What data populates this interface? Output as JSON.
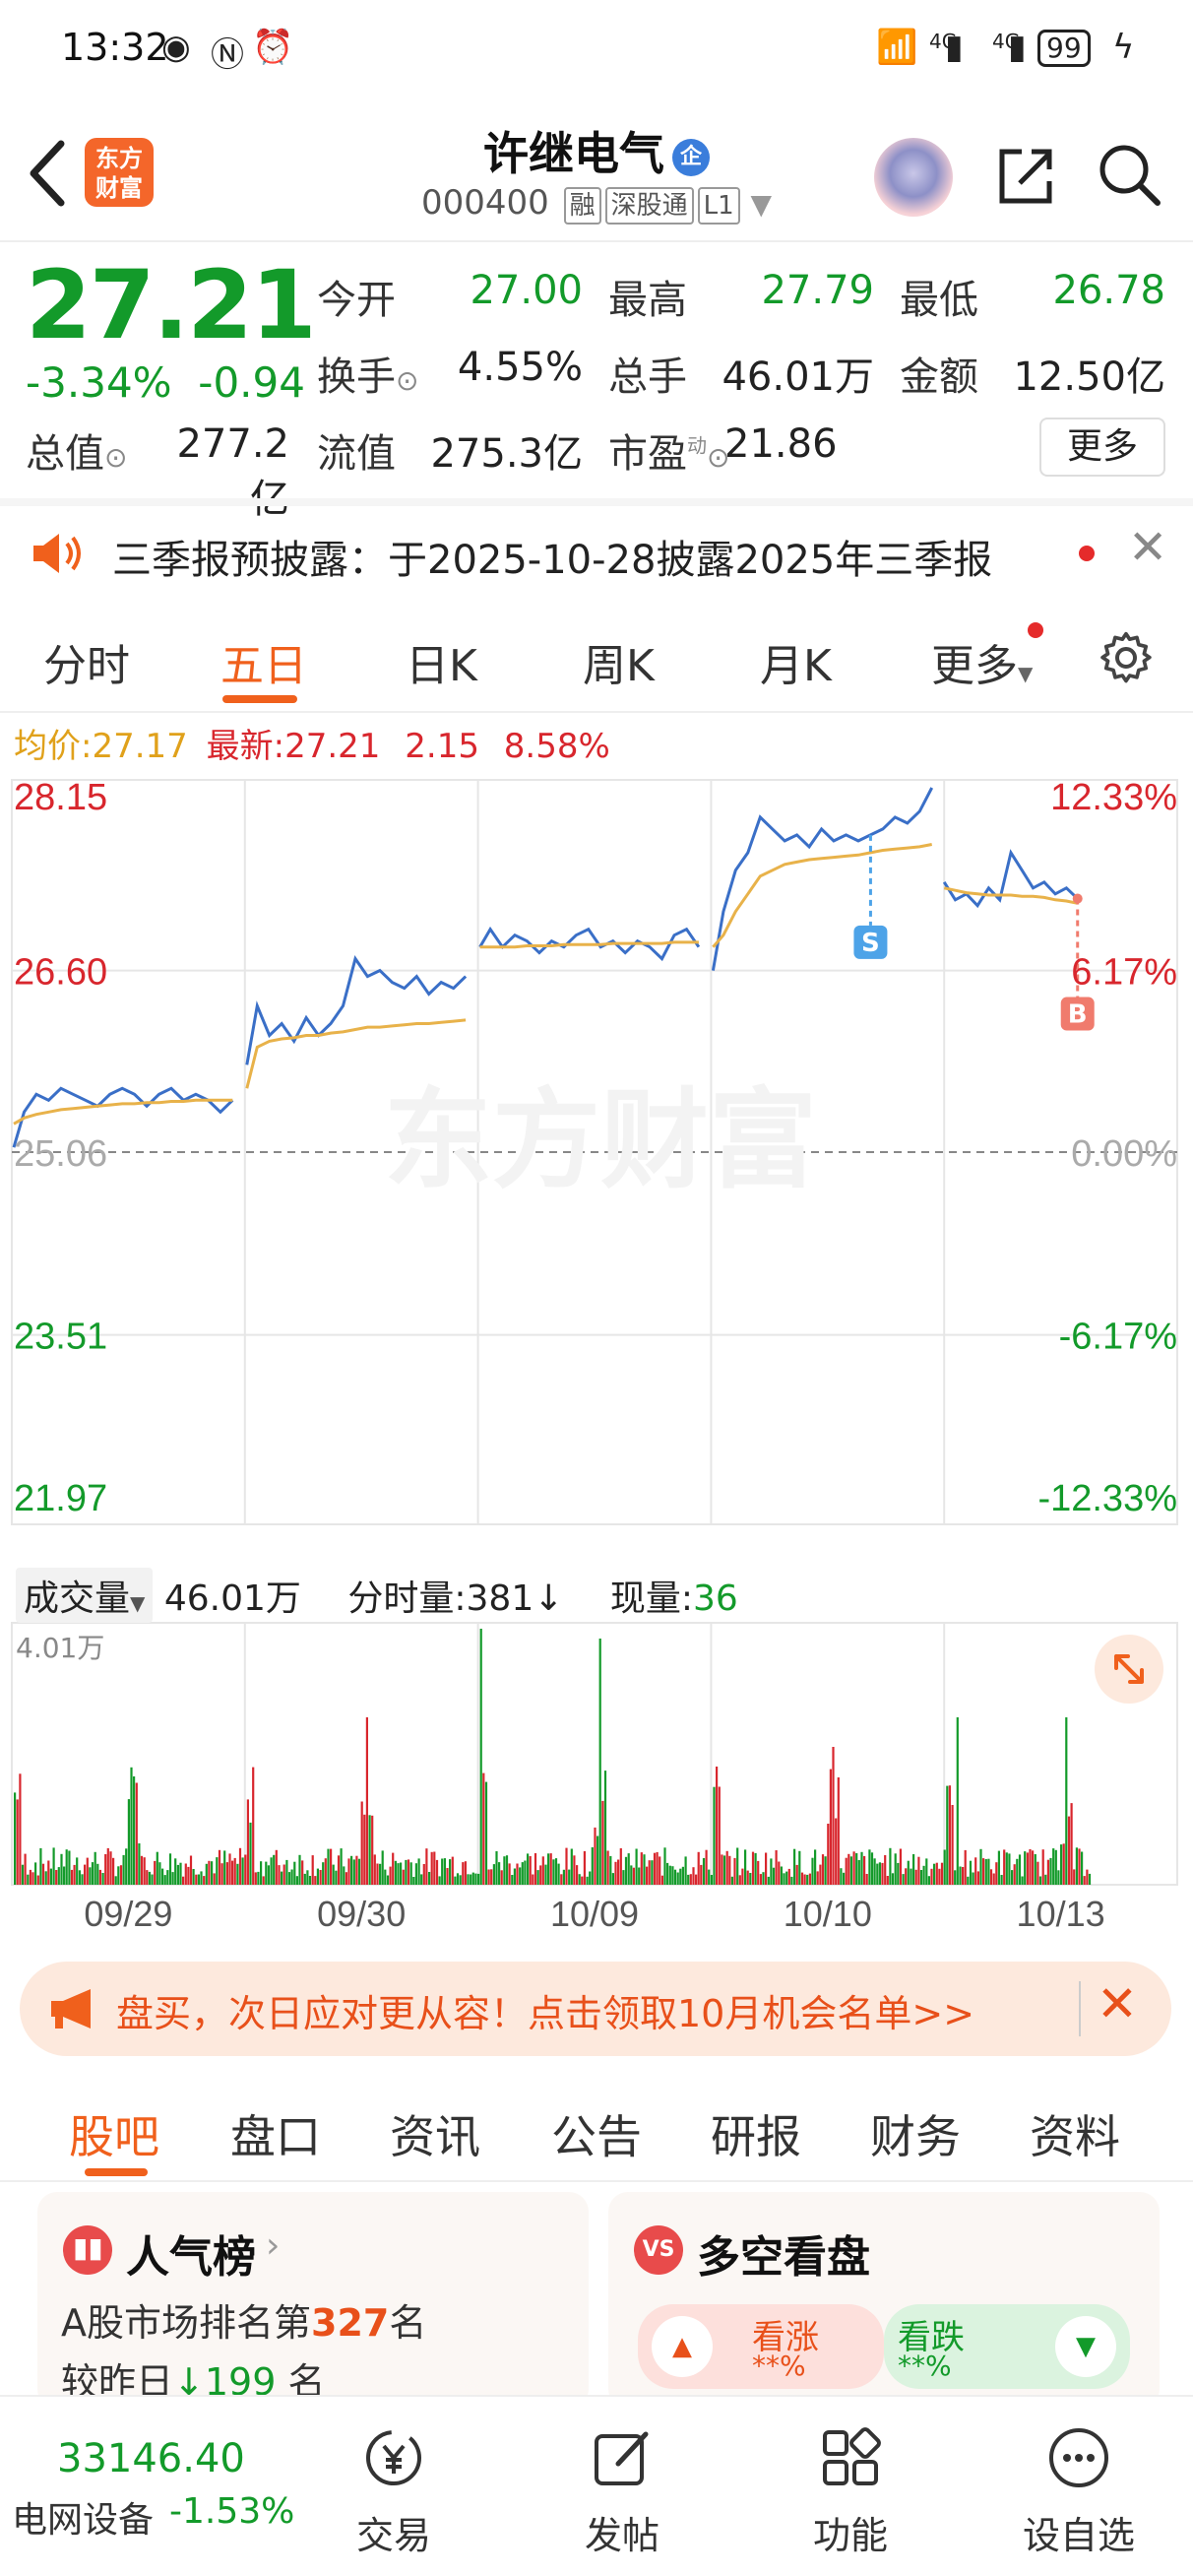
{
  "status_bar": {
    "time": "13:32",
    "battery": "99",
    "network": "4G"
  },
  "header": {
    "brand_logo": "东方\n财富",
    "stock_name": "许继电气",
    "name_badge": "企",
    "stock_code": "000400",
    "tags": [
      "融",
      "深股通",
      "L1"
    ]
  },
  "quote": {
    "price": "27.21",
    "change_pct": "-3.34%",
    "change": "-0.94",
    "fields": [
      {
        "label": "今开",
        "value": "27.00",
        "color": "green"
      },
      {
        "label": "最高",
        "value": "27.79",
        "color": "green"
      },
      {
        "label": "最低",
        "value": "26.78",
        "color": "green"
      },
      {
        "label": "换手",
        "value": "4.55%",
        "color": "black"
      },
      {
        "label": "总手",
        "value": "46.01万",
        "color": "black"
      },
      {
        "label": "金额",
        "value": "12.50亿",
        "color": "black"
      },
      {
        "label": "总值",
        "value": "277.2亿",
        "color": "black"
      },
      {
        "label": "流值",
        "value": "275.3亿",
        "color": "black"
      },
      {
        "label": "市盈",
        "value": "21.86",
        "color": "black"
      }
    ],
    "pe_superscript": "动",
    "more_label": "更多"
  },
  "notice": {
    "text": "三季报预披露：于2025-10-28披露2025年三季报"
  },
  "chart_tabs": {
    "items": [
      "分时",
      "五日",
      "日K",
      "周K",
      "月K",
      "更多"
    ],
    "active": "五日"
  },
  "avg_line": {
    "avg_label": "均价:",
    "avg_value": "27.17",
    "latest_label": "最新:",
    "latest_value": "27.21",
    "latest_change": "2.15",
    "latest_pct": "8.58%"
  },
  "chart_data": {
    "type": "line",
    "title": "",
    "x_day_labels": [
      "09/29",
      "09/30",
      "10/09",
      "10/10",
      "10/13"
    ],
    "y_left_ticks": [
      "28.15",
      "26.60",
      "25.06",
      "23.51",
      "21.97"
    ],
    "y_right_ticks": [
      "12.33%",
      "6.17%",
      "0.00%",
      "-6.17%",
      "-12.33%"
    ],
    "ylim": [
      21.97,
      28.15
    ],
    "base_price": 25.06,
    "series": [
      {
        "name": "价格",
        "color": "#3a6fc7",
        "values": [
          25.1,
          25.4,
          25.55,
          25.5,
          25.6,
          25.55,
          25.5,
          25.45,
          25.55,
          25.6,
          25.55,
          25.45,
          25.55,
          25.6,
          25.5,
          25.55,
          25.5,
          25.4,
          25.5,
          25.8,
          26.3,
          26.05,
          26.15,
          26.0,
          26.2,
          26.05,
          26.15,
          26.3,
          26.7,
          26.55,
          26.6,
          26.5,
          26.45,
          26.55,
          26.4,
          26.5,
          26.45,
          26.55,
          26.8,
          26.95,
          26.8,
          26.9,
          26.85,
          26.75,
          26.85,
          26.8,
          26.9,
          26.95,
          26.8,
          26.85,
          26.75,
          26.85,
          26.8,
          26.7,
          26.9,
          26.95,
          26.8,
          26.6,
          27.1,
          27.45,
          27.6,
          27.9,
          27.8,
          27.7,
          27.75,
          27.65,
          27.8,
          27.7,
          27.75,
          27.7,
          27.75,
          27.8,
          27.9,
          27.85,
          27.95,
          28.15,
          27.35,
          27.2,
          27.25,
          27.15,
          27.3,
          27.2,
          27.6,
          27.45,
          27.3,
          27.35,
          27.25,
          27.3,
          27.21
        ]
      },
      {
        "name": "均价",
        "color": "#e8b24a",
        "values": [
          25.3,
          25.35,
          25.38,
          25.4,
          25.42,
          25.43,
          25.44,
          25.45,
          25.46,
          25.47,
          25.47,
          25.48,
          25.48,
          25.49,
          25.49,
          25.5,
          25.5,
          25.5,
          25.5,
          25.6,
          25.95,
          26.0,
          26.02,
          26.03,
          26.05,
          26.05,
          26.07,
          26.08,
          26.1,
          26.12,
          26.12,
          26.13,
          26.14,
          26.15,
          26.15,
          26.16,
          26.17,
          26.18,
          26.8,
          26.8,
          26.8,
          26.8,
          26.81,
          26.81,
          26.81,
          26.82,
          26.82,
          26.82,
          26.82,
          26.83,
          26.83,
          26.83,
          26.83,
          26.83,
          26.84,
          26.84,
          26.84,
          26.8,
          26.9,
          27.1,
          27.25,
          27.4,
          27.45,
          27.5,
          27.52,
          27.54,
          27.55,
          27.56,
          27.57,
          27.58,
          27.6,
          27.62,
          27.63,
          27.64,
          27.65,
          27.67,
          27.3,
          27.28,
          27.26,
          27.25,
          27.24,
          27.24,
          27.24,
          27.23,
          27.23,
          27.22,
          27.2,
          27.19,
          27.17
        ]
      }
    ],
    "markers": [
      {
        "label": "S",
        "color": "#4da3e8"
      },
      {
        "label": "B",
        "color": "#f07b6d"
      }
    ],
    "watermark": "东方财富"
  },
  "volume": {
    "label": "成交量",
    "total": "46.01万",
    "period_label": "分时量:",
    "period_value": "381",
    "now_label": "现量:",
    "now_value": "36",
    "max_label": "4.01万"
  },
  "promo": {
    "text": "盘买，次日应对更从容！点击领取10月机会名单>>"
  },
  "bottom_tabs": {
    "items": [
      "股吧",
      "盘口",
      "资讯",
      "公告",
      "研报",
      "财务",
      "资料"
    ],
    "active": "股吧"
  },
  "cards": {
    "popularity": {
      "title": "人气榜",
      "line1_prefix": "A股市场排名第",
      "line1_rank": "327",
      "line1_suffix": "名",
      "line2_prefix": "较昨日",
      "line2_value": "199",
      "line2_suffix": "名"
    },
    "sentiment": {
      "title": "多空看盘",
      "bull_label": "看涨",
      "bull_value": "**%",
      "bear_label": "看跌",
      "bear_value": "**%"
    }
  },
  "bottom_nav": {
    "index_value": "33146.40",
    "index_name": "电网设备",
    "index_change": "-1.53%",
    "items": [
      "交易",
      "发帖",
      "功能",
      "设自选"
    ]
  },
  "colors": {
    "accent": "#f0601c",
    "down": "#139a2a",
    "up": "#d8262d",
    "price_line": "#3a6fc7",
    "avg_line": "#e8b24a"
  }
}
